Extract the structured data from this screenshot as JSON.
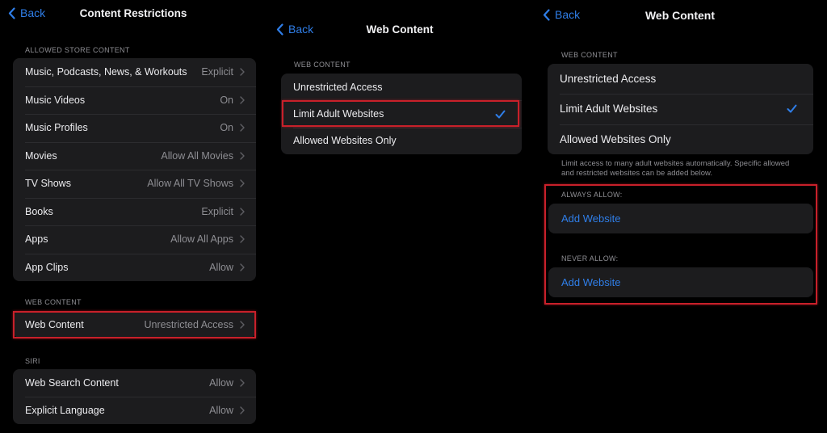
{
  "colors": {
    "accent": "#2f7ee8",
    "highlight": "#c8202a",
    "group_bg": "#1c1c1e",
    "secondary_text": "#8e8e93"
  },
  "panel1": {
    "back_label": "Back",
    "title": "Content Restrictions",
    "sections": [
      {
        "header": "ALLOWED STORE CONTENT",
        "rows": [
          {
            "label": "Music, Podcasts, News, & Workouts",
            "value": "Explicit"
          },
          {
            "label": "Music Videos",
            "value": "On"
          },
          {
            "label": "Music Profiles",
            "value": "On"
          },
          {
            "label": "Movies",
            "value": "Allow All Movies"
          },
          {
            "label": "TV Shows",
            "value": "Allow All TV Shows"
          },
          {
            "label": "Books",
            "value": "Explicit"
          },
          {
            "label": "Apps",
            "value": "Allow All Apps"
          },
          {
            "label": "App Clips",
            "value": "Allow"
          }
        ]
      },
      {
        "header": "WEB CONTENT",
        "rows": [
          {
            "label": "Web Content",
            "value": "Unrestricted Access",
            "highlighted": true
          }
        ]
      },
      {
        "header": "SIRI",
        "rows": [
          {
            "label": "Web Search Content",
            "value": "Allow"
          },
          {
            "label": "Explicit Language",
            "value": "Allow"
          }
        ]
      }
    ]
  },
  "panel2": {
    "back_label": "Back",
    "title": "Web Content",
    "section_header": "WEB CONTENT",
    "options": [
      {
        "label": "Unrestricted Access",
        "selected": false
      },
      {
        "label": "Limit Adult Websites",
        "selected": true,
        "highlighted": true
      },
      {
        "label": "Allowed Websites Only",
        "selected": false
      }
    ]
  },
  "panel3": {
    "back_label": "Back",
    "title": "Web Content",
    "section_header": "WEB CONTENT",
    "options": [
      {
        "label": "Unrestricted Access",
        "selected": false
      },
      {
        "label": "Limit Adult Websites",
        "selected": true
      },
      {
        "label": "Allowed Websites Only",
        "selected": false
      }
    ],
    "footer": "Limit access to many adult websites automatically. Specific allowed and restricted websites can be added below.",
    "always_allow": {
      "header": "ALWAYS ALLOW:",
      "button": "Add Website"
    },
    "never_allow": {
      "header": "NEVER ALLOW:",
      "button": "Add Website"
    }
  }
}
